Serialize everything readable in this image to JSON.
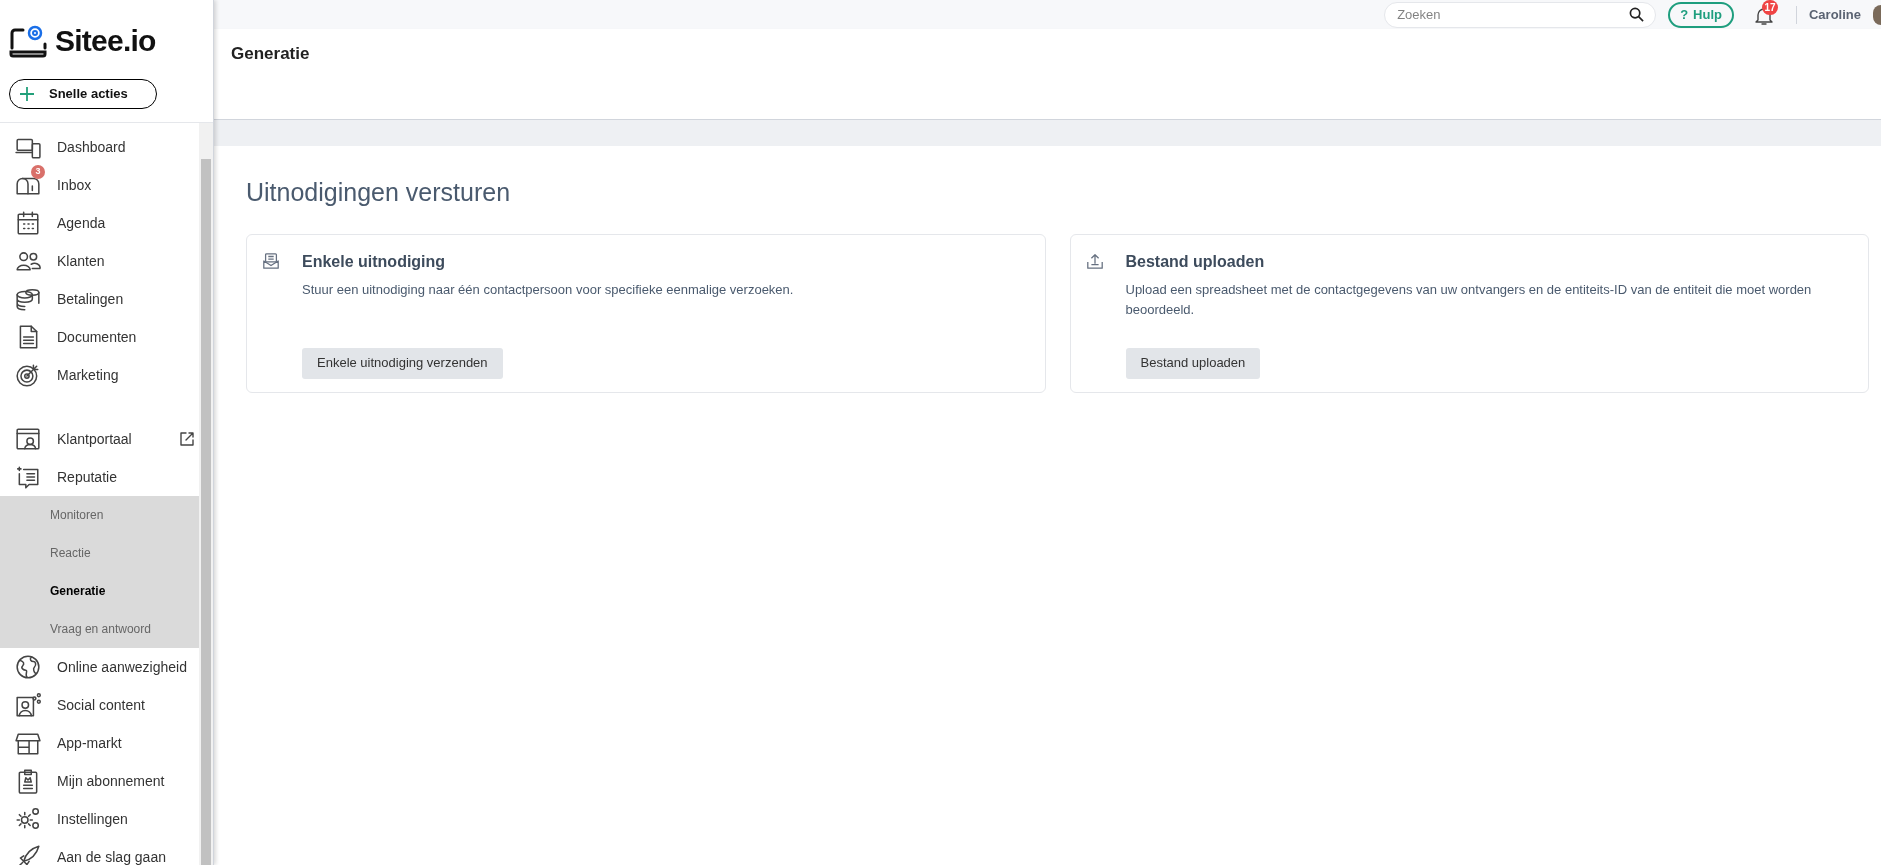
{
  "logo": {
    "text": "Sitee.io"
  },
  "quick_actions": {
    "label": "Snelle acties"
  },
  "sidebar": {
    "sections": [
      {
        "items": [
          {
            "label": "Dashboard"
          },
          {
            "label": "Inbox",
            "badge": "3"
          },
          {
            "label": "Agenda"
          },
          {
            "label": "Klanten"
          },
          {
            "label": "Betalingen"
          },
          {
            "label": "Documenten"
          },
          {
            "label": "Marketing"
          }
        ]
      },
      {
        "items": [
          {
            "label": "Klantportaal",
            "external": true
          },
          {
            "label": "Reputatie",
            "children": [
              {
                "label": "Monitoren",
                "selected": false
              },
              {
                "label": "Reactie",
                "selected": false
              },
              {
                "label": "Generatie",
                "selected": true
              },
              {
                "label": "Vraag en antwoord",
                "selected": false
              }
            ]
          },
          {
            "label": "Online aanwezigheid"
          },
          {
            "label": "Social content"
          },
          {
            "label": "App-markt"
          },
          {
            "label": "Mijn abonnement"
          },
          {
            "label": "Instellingen"
          },
          {
            "label": "Aan de slag gaan"
          }
        ]
      }
    ]
  },
  "topbar": {
    "search": {
      "placeholder": "Zoeken"
    },
    "help": {
      "label": "Hulp",
      "icon_text": "?"
    },
    "notifications": {
      "count": "17"
    },
    "user": {
      "name": "Caroline"
    }
  },
  "page": {
    "title": "Generatie",
    "heading": "Uitnodigingen versturen",
    "cards": [
      {
        "title": "Enkele uitnodiging",
        "description": "Stuur een uitnodiging naar één contactpersoon voor specifieke eenmalige verzoeken.",
        "button": "Enkele uitnodiging verzenden"
      },
      {
        "title": "Bestand uploaden",
        "description": "Upload een spreadsheet met de contactgegevens van uw ontvangers en de entiteits-ID van de entiteit die moet worden beoordeeld.",
        "button": "Bestand uploaden"
      }
    ]
  }
}
